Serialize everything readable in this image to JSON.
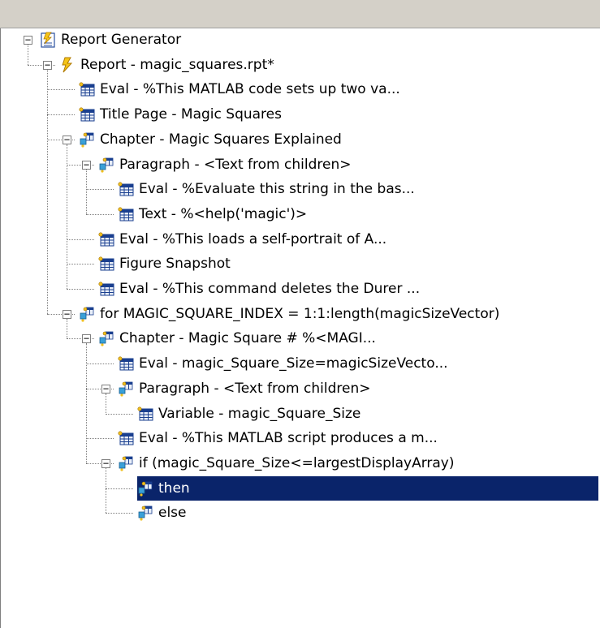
{
  "tree": [
    {
      "label": "Report Generator",
      "icon": "report-generator-icon",
      "level": 0,
      "expander": "minus"
    },
    {
      "label": "Report - magic_squares.rpt*",
      "icon": "report-icon",
      "level": 1,
      "expander": "minus"
    },
    {
      "label": "Eval - %This MATLAB code sets up two va...",
      "icon": "table-icon",
      "level": 2
    },
    {
      "label": "Title Page - Magic Squares",
      "icon": "table-icon",
      "level": 2
    },
    {
      "label": "Chapter - Magic Squares Explained",
      "icon": "component-group-icon",
      "level": 2,
      "expander": "minus"
    },
    {
      "label": "Paragraph - <Text from children>",
      "icon": "component-group-icon",
      "level": 3,
      "expander": "minus"
    },
    {
      "label": "Eval - %Evaluate this string in the bas...",
      "icon": "table-icon",
      "level": 4
    },
    {
      "label": "Text - %<help('magic')>",
      "icon": "table-icon",
      "level": 4
    },
    {
      "label": "Eval - %This loads a self-portrait of A...",
      "icon": "table-icon",
      "level": 3
    },
    {
      "label": "Figure Snapshot",
      "icon": "table-icon",
      "level": 3
    },
    {
      "label": "Eval - %This command deletes the Durer ...",
      "icon": "table-icon",
      "level": 3
    },
    {
      "label": "for MAGIC_SQUARE_INDEX = 1:1:length(magicSizeVector)",
      "icon": "component-group-icon",
      "level": 2,
      "expander": "minus"
    },
    {
      "label": "Chapter - Magic Square # %<MAGI...",
      "icon": "component-group-icon",
      "level": 3,
      "expander": "minus"
    },
    {
      "label": "Eval - magic_Square_Size=magicSizeVecto...",
      "icon": "table-icon",
      "level": 4
    },
    {
      "label": "Paragraph - <Text from children>",
      "icon": "component-group-icon",
      "level": 4,
      "expander": "minus"
    },
    {
      "label": "Variable - magic_Square_Size",
      "icon": "table-icon",
      "level": 5
    },
    {
      "label": "Eval - %This MATLAB script produces a m...",
      "icon": "table-icon",
      "level": 4
    },
    {
      "label": "if (magic_Square_Size<=largestDisplayArray)",
      "icon": "component-group-icon",
      "level": 4,
      "expander": "minus"
    },
    {
      "label": "then",
      "icon": "component-group-icon",
      "level": 5,
      "selected": true
    },
    {
      "label": "else",
      "icon": "component-group-icon",
      "level": 5
    }
  ],
  "colors": {
    "selection": "#0a246a",
    "titlebar": "#d4d0c8"
  }
}
